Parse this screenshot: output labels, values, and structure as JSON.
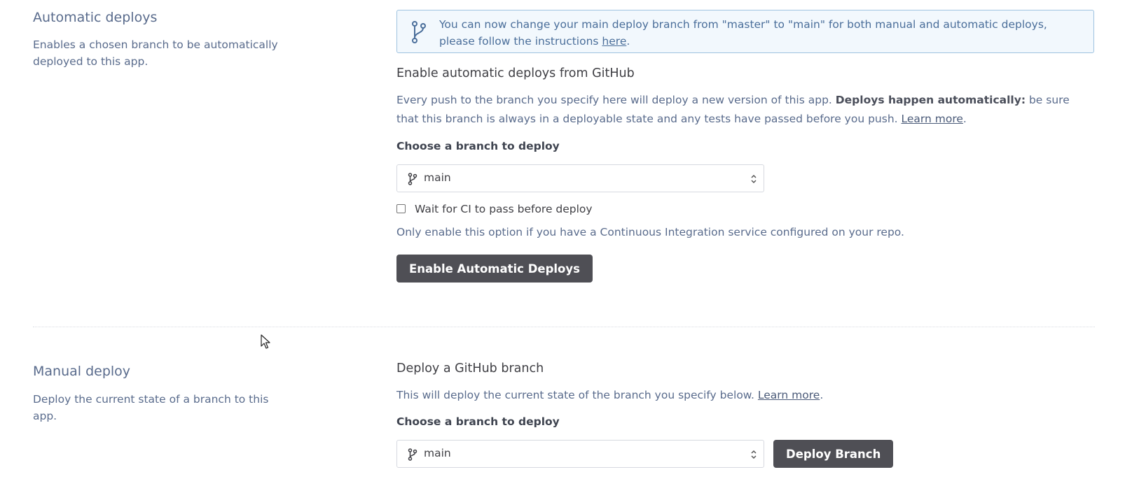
{
  "automatic": {
    "title": "Automatic deploys",
    "description": "Enables a chosen branch to be automatically deployed to this app.",
    "banner": {
      "text_before": "You can now change your main deploy branch from \"master\" to \"main\" for both manual and automatic deploys, please follow the instructions ",
      "link": "here",
      "text_after": "."
    },
    "heading": "Enable automatic deploys from GitHub",
    "para_start": "Every push to the branch you specify here will deploy a new version of this app. ",
    "para_bold": "Deploys happen automatically:",
    "para_end": " be sure that this branch is always in a deployable state and any tests have passed before you push. ",
    "learn_more": "Learn more",
    "period": ".",
    "branch_label": "Choose a branch to deploy",
    "branch_value": "main",
    "ci_checkbox_label": "Wait for CI to pass before deploy",
    "ci_note": "Only enable this option if you have a Continuous Integration service configured on your repo.",
    "enable_button": "Enable Automatic Deploys"
  },
  "manual": {
    "title": "Manual deploy",
    "description": "Deploy the current state of a branch to this app.",
    "heading": "Deploy a GitHub branch",
    "para": "This will deploy the current state of the branch you specify below. ",
    "learn_more": "Learn more",
    "period": ".",
    "branch_label": "Choose a branch to deploy",
    "branch_value": "main",
    "deploy_button": "Deploy Branch"
  },
  "colors": {
    "accent_text": "#596b8c",
    "banner_border": "#9fc3e0",
    "banner_bg": "#f2f8fd",
    "button_bg": "#4f4f55"
  },
  "icons": {
    "branch": "git-branch-icon",
    "select_arrows": "chevron-up-down-icon",
    "cursor": "mouse-pointer-icon"
  }
}
